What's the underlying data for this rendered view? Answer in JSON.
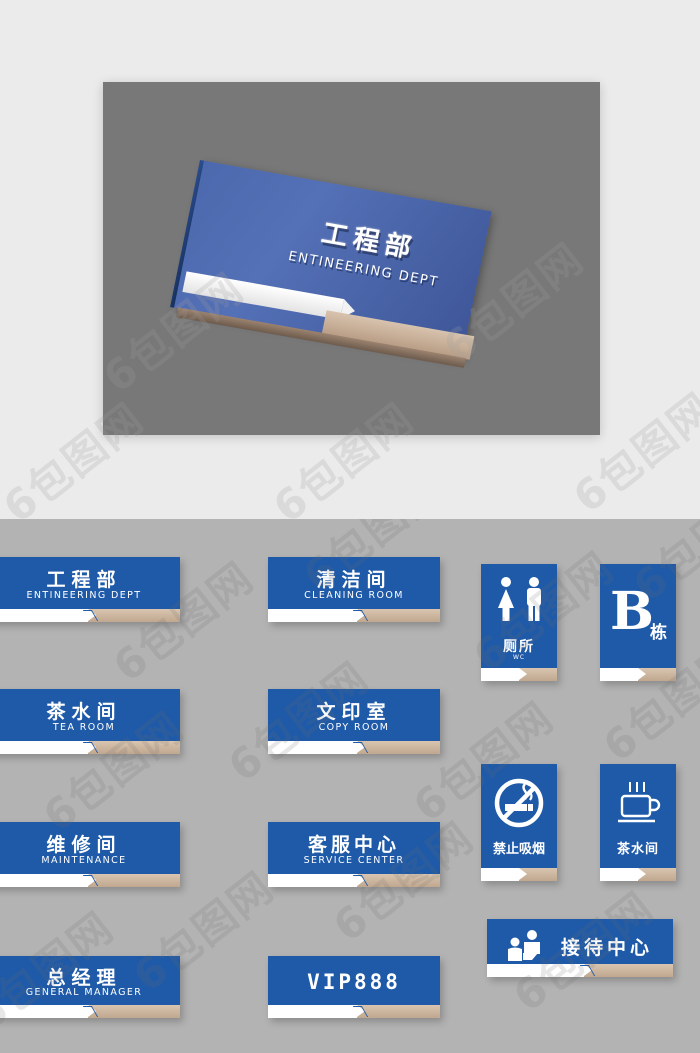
{
  "colors": {
    "plate_blue": "#1e5aa8",
    "hero_blue": "#4d69ae",
    "beige_strip": "#d9c5b0",
    "top_bg": "#ebebeb",
    "grid_bg": "#b3b3b3",
    "hero_panel_bg": "#787878",
    "text_white": "#ffffff"
  },
  "hero": {
    "sign": {
      "cn": "工程部",
      "en": "ENTINEERING DEPT"
    }
  },
  "watermark": {
    "text": "6包图网"
  },
  "signs": {
    "wide": [
      {
        "cn": "工程部",
        "en": "ENTINEERING DEPT"
      },
      {
        "cn": "清洁间",
        "en": "CLEANING ROOM"
      },
      {
        "cn": "茶水间",
        "en": "TEA ROOM"
      },
      {
        "cn": "文印室",
        "en": "COPY ROOM"
      },
      {
        "cn": "维修间",
        "en": "MAINTENANCE"
      },
      {
        "cn": "客服中心",
        "en": "SERVICE CENTER"
      },
      {
        "cn": "总经理",
        "en": "GENERAL MANAGER"
      },
      {
        "cn": "VIP888",
        "en": ""
      }
    ],
    "restroom": {
      "cn": "厕所",
      "en": "WC",
      "icon": "restroom-male-female-icon"
    },
    "building": {
      "letter": "B",
      "cn": "栋",
      "icon": "building-letter-icon"
    },
    "nosmoking": {
      "cn": "禁止吸烟",
      "icon": "no-smoking-icon"
    },
    "pantry": {
      "cn": "茶水间",
      "icon": "coffee-cup-icon"
    },
    "reception": {
      "cn": "接待中心",
      "icon": "reception-desk-icon"
    }
  }
}
